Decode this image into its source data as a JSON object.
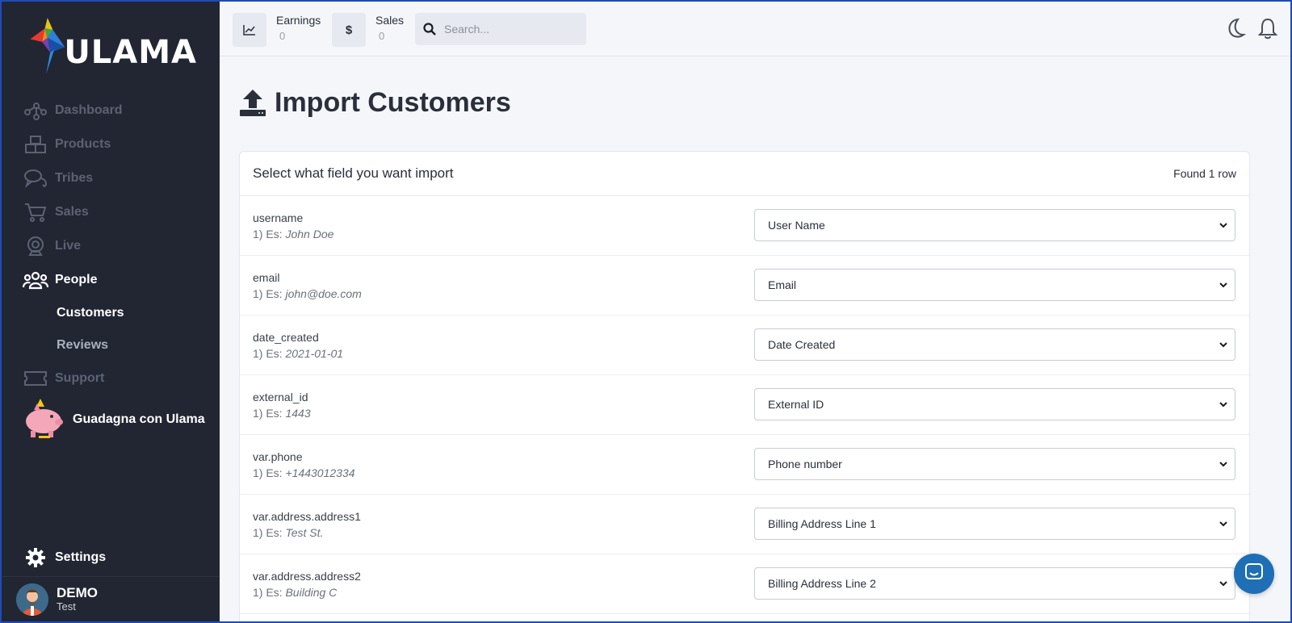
{
  "brand": {
    "name": "ULAMA"
  },
  "sidebar": {
    "items": [
      {
        "label": "Dashboard",
        "icon": "graph-network-icon"
      },
      {
        "label": "Products",
        "icon": "boxes-icon"
      },
      {
        "label": "Tribes",
        "icon": "chat-bubbles-icon"
      },
      {
        "label": "Sales",
        "icon": "cart-icon"
      },
      {
        "label": "Live",
        "icon": "webcam-icon"
      },
      {
        "label": "People",
        "icon": "people-group-icon"
      }
    ],
    "people_sub": [
      {
        "label": "Customers"
      },
      {
        "label": "Reviews"
      }
    ],
    "support": {
      "label": "Support",
      "icon": "ticket-icon"
    },
    "promo": {
      "label": "Guadagna con Ulama",
      "icon": "piggy-bank-icon"
    },
    "settings": {
      "label": "Settings",
      "icon": "gear-icon"
    },
    "user": {
      "name": "DEMO",
      "role": "Test"
    }
  },
  "topbar": {
    "earnings": {
      "label": "Earnings",
      "value": "0"
    },
    "sales": {
      "label": "Sales",
      "value": "0"
    },
    "search": {
      "placeholder": "Search..."
    }
  },
  "page": {
    "title": "Import Customers"
  },
  "card": {
    "title": "Select what field you want import",
    "count": "Found 1 row",
    "rows": [
      {
        "field": "username",
        "prefix": "1) Es: ",
        "example": "John Doe",
        "selected": "User Name"
      },
      {
        "field": "email",
        "prefix": "1) Es: ",
        "example": "john@doe.com",
        "selected": "Email"
      },
      {
        "field": "date_created",
        "prefix": "1) Es: ",
        "example": "2021-01-01",
        "selected": "Date Created"
      },
      {
        "field": "external_id",
        "prefix": "1) Es: ",
        "example": "1443",
        "selected": "External ID"
      },
      {
        "field": "var.phone",
        "prefix": "1) Es: ",
        "example": "+1443012334",
        "selected": "Phone number"
      },
      {
        "field": "var.address.address1",
        "prefix": "1) Es: ",
        "example": "Test St.",
        "selected": "Billing Address Line 1"
      },
      {
        "field": "var.address.address2",
        "prefix": "1) Es: ",
        "example": "Building C",
        "selected": "Billing Address Line 2"
      }
    ]
  },
  "colors": {
    "sidebar": "#222633",
    "accent": "#1e6fb5",
    "background": "#f4f6fa"
  }
}
